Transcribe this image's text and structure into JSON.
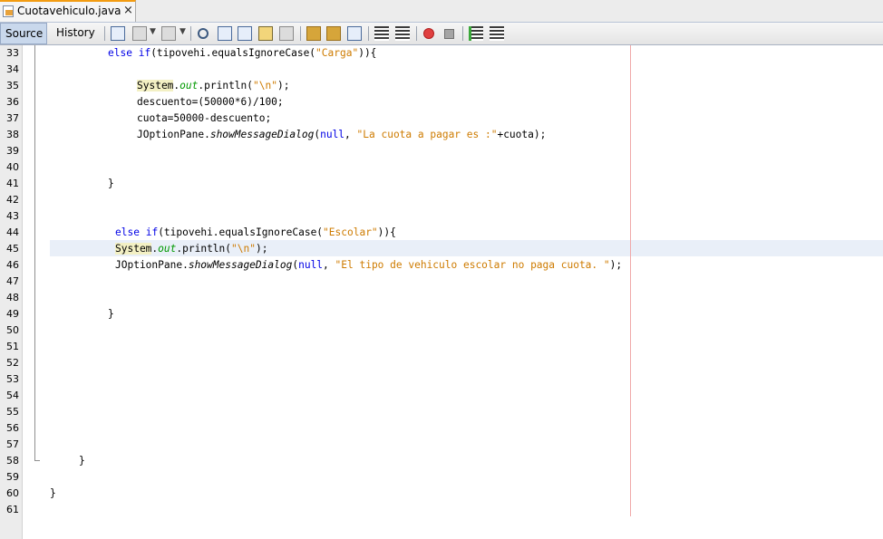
{
  "tab": {
    "title": "Cuotavehiculo.java",
    "close": "×"
  },
  "toolbar": {
    "source_label": "Source",
    "history_label": "History"
  },
  "editor": {
    "line_numbers": [
      "33",
      "34",
      "35",
      "36",
      "37",
      "38",
      "39",
      "40",
      "41",
      "42",
      "43",
      "44",
      "45",
      "46",
      "47",
      "48",
      "49",
      "50",
      "51",
      "52",
      "53",
      "54",
      "55",
      "56",
      "57",
      "58",
      "59",
      "60",
      "61"
    ],
    "lines": {
      "l33": {
        "kw1": "else",
        "kw2": "if",
        "a": "(tipovehi.equalsIgnoreCase(",
        "s": "\"Carga\"",
        "b": ")){"
      },
      "l35": {
        "sys": "System",
        "dot": ".",
        "out": "out",
        "a": ".println(",
        "s": "\"\\n\"",
        "b": ");"
      },
      "l36": {
        "text": "descuento=(50000*6)/100;"
      },
      "l37": {
        "text": "cuota=50000-descuento;"
      },
      "l38": {
        "a": "JOptionPane.",
        "m": "showMessageDialog",
        "b": "(",
        "kw": "null",
        "c": ", ",
        "s": "\"La cuota a pagar es :\"",
        "d": "+cuota);"
      },
      "l41": {
        "text": "}"
      },
      "l44": {
        "kw1": "else",
        "kw2": "if",
        "a": "(tipovehi.equalsIgnoreCase(",
        "s": "\"Escolar\"",
        "b": ")){"
      },
      "l45": {
        "sys": "System",
        "dot": ".",
        "out": "out",
        "a": ".println(",
        "s": "\"\\n\"",
        "b": ");"
      },
      "l46": {
        "a": "JOptionPane.",
        "m": "showMessageDialog",
        "b": "(",
        "kw": "null",
        "c": ", ",
        "s": "\"El tipo de vehiculo escolar no paga cuota. \"",
        "d": ");"
      },
      "l49": {
        "text": "}"
      },
      "l58": {
        "text": "}"
      },
      "l60": {
        "text": "}"
      }
    },
    "colors": {
      "keyword": "#0000e6",
      "string": "#ce7b00",
      "field": "#009900",
      "margin_line": "#f0a8a8",
      "current_line": "#e9eff8"
    }
  }
}
